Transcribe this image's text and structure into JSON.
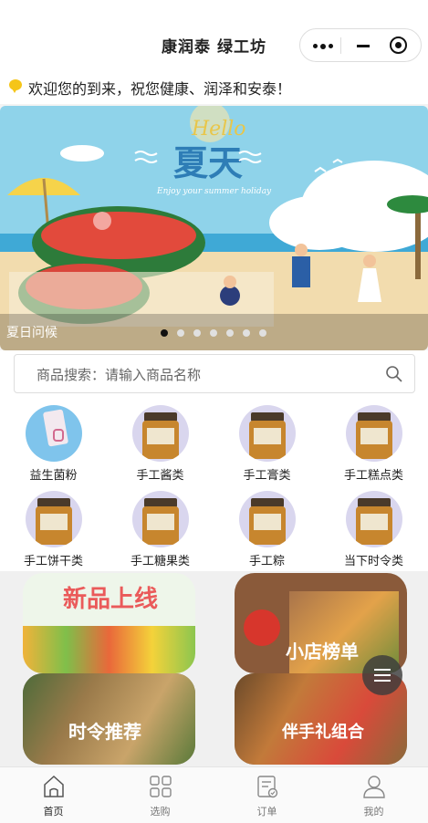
{
  "header": {
    "title": "康润泰 绿工坊"
  },
  "notice": {
    "text": "欢迎您的到来，祝您健康、润泽和安泰！"
  },
  "banner": {
    "caption": "夏日问候",
    "hello": "Hello",
    "title": "夏天",
    "subtitle": "Enjoy your summer holiday",
    "slide_count": 7,
    "active_slide": 1
  },
  "search": {
    "placeholder": "商品搜索：请输入商品名称"
  },
  "categories": [
    {
      "label": "益生菌粉"
    },
    {
      "label": "手工酱类"
    },
    {
      "label": "手工膏类"
    },
    {
      "label": "手工糕点类"
    },
    {
      "label": "手工饼干类"
    },
    {
      "label": "手工糖果类"
    },
    {
      "label": "手工粽"
    },
    {
      "label": "当下时令类"
    }
  ],
  "tiles": [
    {
      "label": "新品上线"
    },
    {
      "label": "小店榜单"
    },
    {
      "label": "时令推荐"
    },
    {
      "label": "伴手礼组合"
    }
  ],
  "tabbar": [
    {
      "label": "首页",
      "icon": "home-icon",
      "active": true
    },
    {
      "label": "选购",
      "icon": "grid-icon",
      "active": false
    },
    {
      "label": "订单",
      "icon": "order-icon",
      "active": false
    },
    {
      "label": "我的",
      "icon": "user-icon",
      "active": false
    }
  ]
}
